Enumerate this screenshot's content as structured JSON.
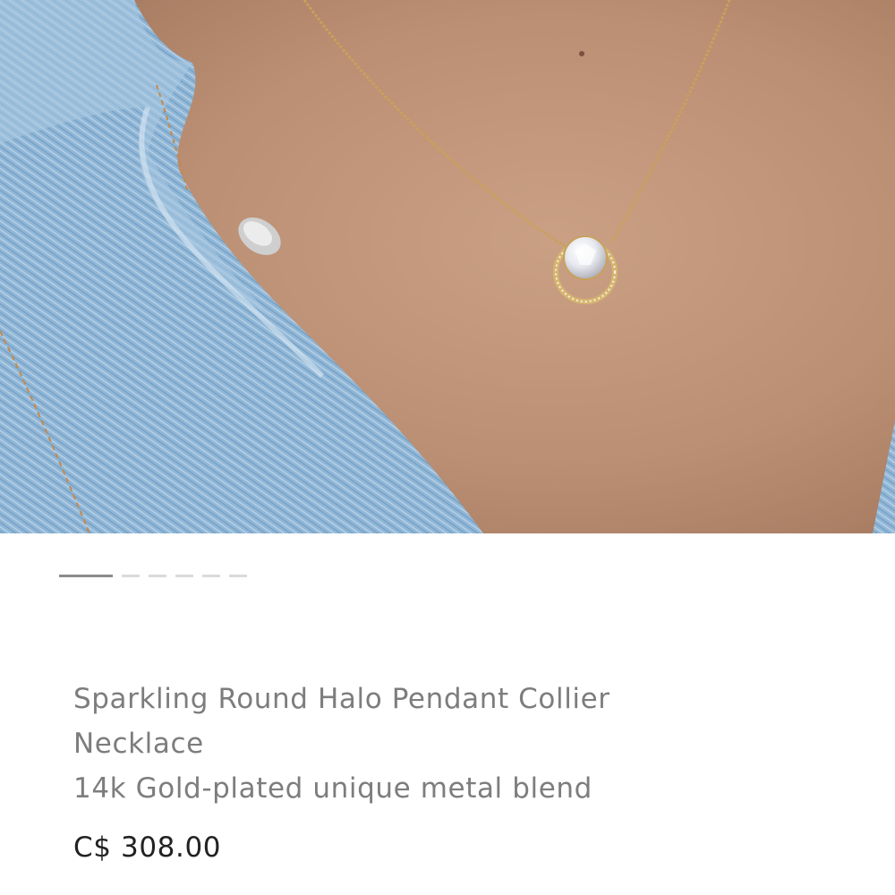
{
  "product": {
    "name": "Sparkling Round Halo Pendant Collier Necklace",
    "material": "14k Gold-plated unique metal blend",
    "price": "C$ 308.00"
  },
  "carousel": {
    "total_images": 6,
    "active_index": 0
  },
  "image": {
    "description_icon": "product-photo-necklace"
  },
  "colors": {
    "text_primary": "#222222",
    "text_secondary": "#7d7d7d",
    "indicator_active": "#8c8c8c",
    "indicator_inactive": "#dadada",
    "background": "#ffffff"
  }
}
